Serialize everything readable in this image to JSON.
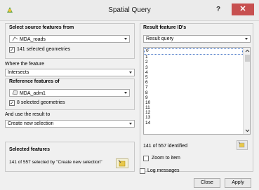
{
  "window": {
    "title": "Spatial Query",
    "help": "?",
    "close": "✕"
  },
  "source": {
    "group_title": "Select source features from",
    "layer": "MDA_roads",
    "selected_checkbox": true,
    "selected_label": "141 selected geometries"
  },
  "where": {
    "label": "Where the feature",
    "value": "Intersects"
  },
  "reference": {
    "group_title": "Reference features of",
    "layer": "MDA_adm1",
    "selected_checkbox": true,
    "selected_label": "8 selected geometries"
  },
  "use_result": {
    "label": "And use the result to",
    "value": "Create new selection"
  },
  "selected_features": {
    "group_title": "Selected features",
    "status": "141 of 557 selected by \"Create new selection\""
  },
  "result": {
    "group_title": "Result feature ID's",
    "combo_value": "Result query",
    "ids": [
      "0",
      "1",
      "2",
      "3",
      "4",
      "5",
      "6",
      "7",
      "8",
      "9",
      "10",
      "11",
      "12",
      "13",
      "14"
    ],
    "identified": "141 of 557 identified",
    "zoom_label": "Zoom to item",
    "zoom_checked": false
  },
  "log": {
    "label": "Log messages",
    "checked": false
  },
  "buttons": {
    "close": "Close",
    "apply": "Apply"
  }
}
